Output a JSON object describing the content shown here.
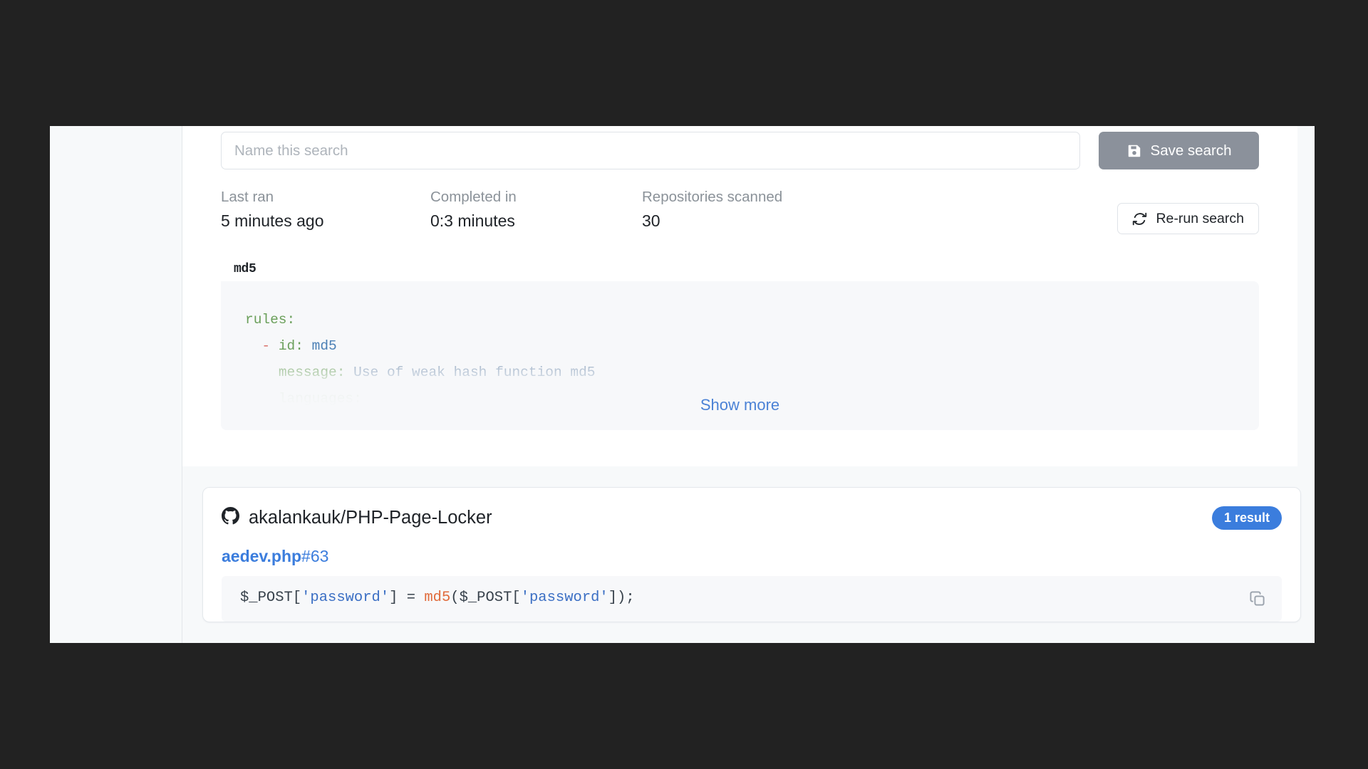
{
  "sidebar": {
    "items": []
  },
  "search_header": {
    "name_input_placeholder": "Name this search",
    "name_input_value": "",
    "save_label": "Save search",
    "save_icon": "floppy-save-icon",
    "rerun_label": "Re-run search",
    "rerun_icon": "refresh-sync-icon"
  },
  "stats": [
    {
      "label": "Last ran",
      "value": "5 minutes ago"
    },
    {
      "label": "Completed in",
      "value": "0:3 minutes"
    },
    {
      "label": "Repositories scanned",
      "value": "30"
    }
  ],
  "rule_panel": {
    "tab_label": "md5",
    "download_icon": "download-icon",
    "copy_icon": "copy-icon",
    "show_more_label": "Show more",
    "code_lines": [
      {
        "indent": 0,
        "segments": [
          {
            "text": "rules:",
            "token": "key"
          }
        ]
      },
      {
        "indent": 1,
        "segments": [
          {
            "text": "- ",
            "token": "dash"
          },
          {
            "text": "id: ",
            "token": "key"
          },
          {
            "text": "md5",
            "token": "val"
          }
        ]
      },
      {
        "indent": 2,
        "segments": [
          {
            "text": "message: ",
            "token": "key"
          },
          {
            "text": "Use of weak hash function md5",
            "token": "msg"
          }
        ]
      },
      {
        "indent": 2,
        "segments": [
          {
            "text": "languages:",
            "token": "key"
          }
        ]
      }
    ],
    "code_plain": "rules:\n  - id: md5\n    message: Use of weak hash function md5\n    languages:"
  },
  "results": [
    {
      "repo_icon": "github-icon",
      "repo_name": "akalankauk/PHP-Page-Locker",
      "result_badge": "1 result",
      "file_name": "aedev.php",
      "line_ref": "#63",
      "copy_icon": "copy-icon",
      "snippet_plain": "$_POST['password'] = md5($_POST['password']);",
      "snippet_segments": [
        {
          "text": "$_POST[",
          "token": "plain"
        },
        {
          "text": "'password'",
          "token": "str"
        },
        {
          "text": "] = ",
          "token": "plain"
        },
        {
          "text": "md5",
          "token": "fn"
        },
        {
          "text": "($_POST[",
          "token": "plain"
        },
        {
          "text": "'password'",
          "token": "str"
        },
        {
          "text": "]);",
          "token": "plain"
        }
      ]
    }
  ],
  "colors": {
    "page_backdrop": "#222222",
    "sidebar_bg": "#f7f9fa",
    "card_bg": "#ffffff",
    "code_bg": "#f7f8fa",
    "link_blue": "#4b82d6",
    "badge_blue": "#3b7ddd",
    "save_gray": "#8b919b",
    "text_primary": "#1f2328",
    "text_muted": "#8b9299"
  }
}
